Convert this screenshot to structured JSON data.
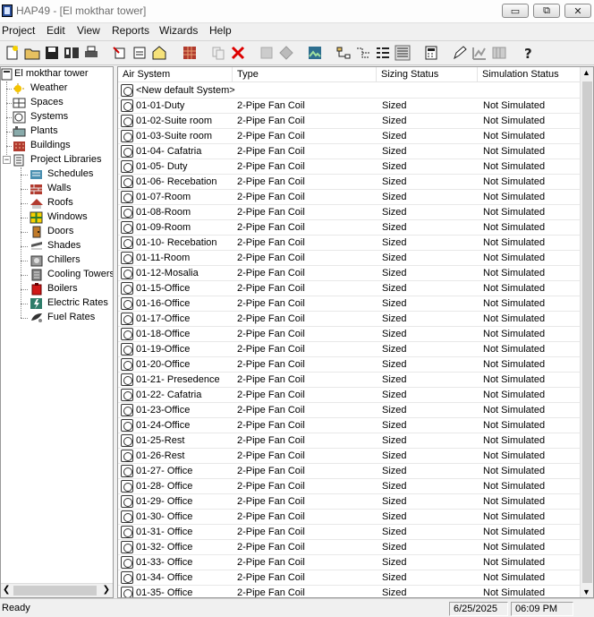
{
  "window": {
    "title": "HAP49 - [El mokthar tower]",
    "minimize": "▭",
    "restore": "⧉",
    "close": "✕"
  },
  "menu": [
    "Project",
    "Edit",
    "View",
    "Reports",
    "Wizards",
    "Help"
  ],
  "toolbar_icons": [
    "new-project-icon",
    "open-project-icon",
    "save-project-icon",
    "archive-icon",
    "print-icon",
    "new-item-icon",
    "properties-icon",
    "building-icon",
    "copy-icon",
    "delete-icon",
    "cut-icon",
    "paste-icon",
    "image-icon",
    "hierarchy-icon",
    "network-icon",
    "list-view-icon",
    "details-view-icon",
    "calculator-icon",
    "edit-icon",
    "chart-icon",
    "grid-icon",
    "help-icon"
  ],
  "tree": {
    "root": "El mokthar tower",
    "items": [
      {
        "label": "Weather",
        "icon": "weather-icon"
      },
      {
        "label": "Spaces",
        "icon": "spaces-icon"
      },
      {
        "label": "Systems",
        "icon": "systems-icon"
      },
      {
        "label": "Plants",
        "icon": "plants-icon"
      },
      {
        "label": "Buildings",
        "icon": "buildings-icon"
      },
      {
        "label": "Project Libraries",
        "icon": "libraries-icon"
      }
    ],
    "library_items": [
      {
        "label": "Schedules",
        "icon": "schedules-icon"
      },
      {
        "label": "Walls",
        "icon": "walls-icon"
      },
      {
        "label": "Roofs",
        "icon": "roofs-icon"
      },
      {
        "label": "Windows",
        "icon": "windows-icon"
      },
      {
        "label": "Doors",
        "icon": "doors-icon"
      },
      {
        "label": "Shades",
        "icon": "shades-icon"
      },
      {
        "label": "Chillers",
        "icon": "chillers-icon"
      },
      {
        "label": "Cooling Towers",
        "icon": "cooling-towers-icon"
      },
      {
        "label": "Boilers",
        "icon": "boilers-icon"
      },
      {
        "label": "Electric Rates",
        "icon": "electric-rates-icon"
      },
      {
        "label": "Fuel Rates",
        "icon": "fuel-rates-icon"
      }
    ]
  },
  "table": {
    "columns": [
      "Air System",
      "Type",
      "Sizing Status",
      "Simulation Status"
    ],
    "rows": [
      [
        "<New default System>",
        "",
        "",
        ""
      ],
      [
        "01-01-Duty",
        "2-Pipe Fan Coil",
        "Sized",
        "Not Simulated"
      ],
      [
        "01-02-Suite room",
        "2-Pipe Fan Coil",
        "Sized",
        "Not Simulated"
      ],
      [
        "01-03-Suite room",
        "2-Pipe Fan Coil",
        "Sized",
        "Not Simulated"
      ],
      [
        "01-04- Cafatria",
        "2-Pipe Fan Coil",
        "Sized",
        "Not Simulated"
      ],
      [
        "01-05- Duty",
        "2-Pipe Fan Coil",
        "Sized",
        "Not Simulated"
      ],
      [
        "01-06- Recebation",
        "2-Pipe Fan Coil",
        "Sized",
        "Not Simulated"
      ],
      [
        "01-07-Room",
        "2-Pipe Fan Coil",
        "Sized",
        "Not Simulated"
      ],
      [
        "01-08-Room",
        "2-Pipe Fan Coil",
        "Sized",
        "Not Simulated"
      ],
      [
        "01-09-Room",
        "2-Pipe Fan Coil",
        "Sized",
        "Not Simulated"
      ],
      [
        "01-10- Recebation",
        "2-Pipe Fan Coil",
        "Sized",
        "Not Simulated"
      ],
      [
        "01-11-Room",
        "2-Pipe Fan Coil",
        "Sized",
        "Not Simulated"
      ],
      [
        "01-12-Mosalia",
        "2-Pipe Fan Coil",
        "Sized",
        "Not Simulated"
      ],
      [
        "01-15-Office",
        "2-Pipe Fan Coil",
        "Sized",
        "Not Simulated"
      ],
      [
        "01-16-Office",
        "2-Pipe Fan Coil",
        "Sized",
        "Not Simulated"
      ],
      [
        "01-17-Office",
        "2-Pipe Fan Coil",
        "Sized",
        "Not Simulated"
      ],
      [
        "01-18-Office",
        "2-Pipe Fan Coil",
        "Sized",
        "Not Simulated"
      ],
      [
        "01-19-Office",
        "2-Pipe Fan Coil",
        "Sized",
        "Not Simulated"
      ],
      [
        "01-20-Office",
        "2-Pipe Fan Coil",
        "Sized",
        "Not Simulated"
      ],
      [
        "01-21- Presedence",
        "2-Pipe Fan Coil",
        "Sized",
        "Not Simulated"
      ],
      [
        "01-22- Cafatria",
        "2-Pipe Fan Coil",
        "Sized",
        "Not Simulated"
      ],
      [
        "01-23-Office",
        "2-Pipe Fan Coil",
        "Sized",
        "Not Simulated"
      ],
      [
        "01-24-Office",
        "2-Pipe Fan Coil",
        "Sized",
        "Not Simulated"
      ],
      [
        "01-25-Rest",
        "2-Pipe Fan Coil",
        "Sized",
        "Not Simulated"
      ],
      [
        "01-26-Rest",
        "2-Pipe Fan Coil",
        "Sized",
        "Not Simulated"
      ],
      [
        "01-27- Office",
        "2-Pipe Fan Coil",
        "Sized",
        "Not Simulated"
      ],
      [
        "01-28- Office",
        "2-Pipe Fan Coil",
        "Sized",
        "Not Simulated"
      ],
      [
        "01-29- Office",
        "2-Pipe Fan Coil",
        "Sized",
        "Not Simulated"
      ],
      [
        "01-30- Office",
        "2-Pipe Fan Coil",
        "Sized",
        "Not Simulated"
      ],
      [
        "01-31- Office",
        "2-Pipe Fan Coil",
        "Sized",
        "Not Simulated"
      ],
      [
        "01-32- Office",
        "2-Pipe Fan Coil",
        "Sized",
        "Not Simulated"
      ],
      [
        "01-33- Office",
        "2-Pipe Fan Coil",
        "Sized",
        "Not Simulated"
      ],
      [
        "01-34- Office",
        "2-Pipe Fan Coil",
        "Sized",
        "Not Simulated"
      ],
      [
        "01-35- Office",
        "2-Pipe Fan Coil",
        "Sized",
        "Not Simulated"
      ]
    ]
  },
  "status": {
    "left": "Ready",
    "date": "6/25/2025",
    "time": "06:09 PM"
  }
}
